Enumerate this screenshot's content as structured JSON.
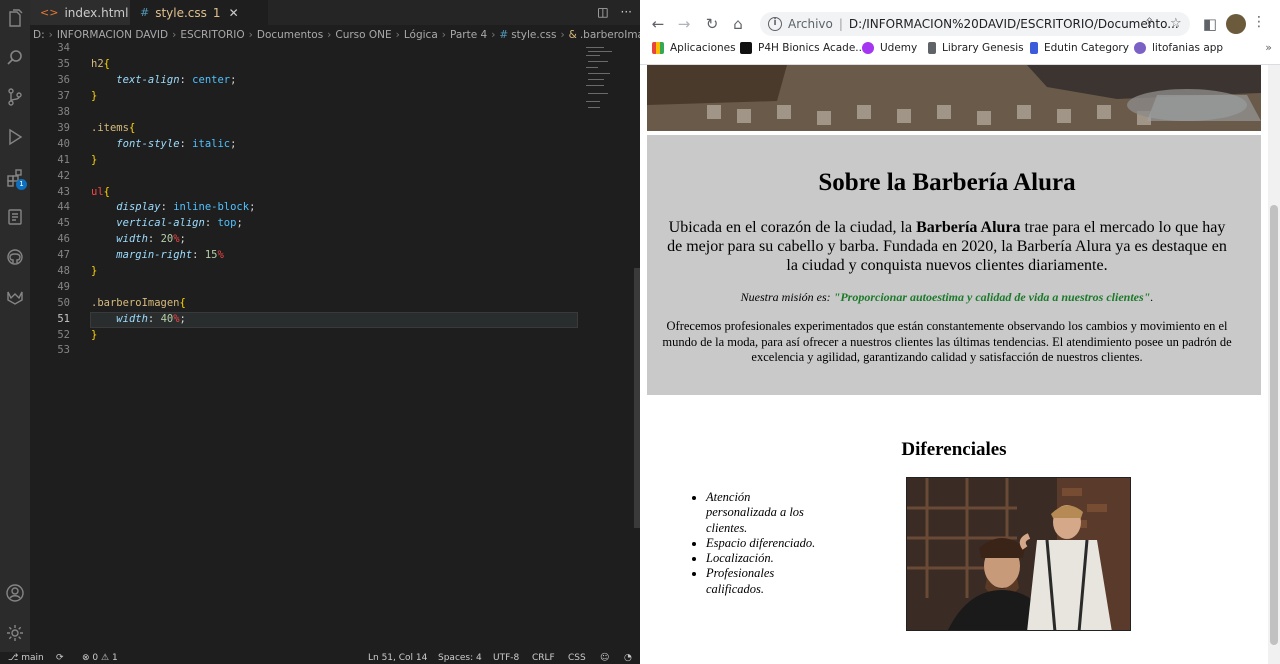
{
  "vscode": {
    "tabs": [
      {
        "icon": "<>",
        "label": "index.html"
      },
      {
        "icon": "#",
        "label": "style.css",
        "modified": "1"
      }
    ],
    "breadcrumb": [
      "D:",
      "INFORMACION DAVID",
      "ESCRITORIO",
      "Documentos",
      "Curso ONE",
      "Lógica",
      "Parte 4",
      "style.css",
      ".barberoImagen"
    ],
    "line_numbers": [
      "34",
      "35",
      "36",
      "37",
      "38",
      "39",
      "40",
      "41",
      "42",
      "43",
      "44",
      "45",
      "46",
      "47",
      "48",
      "49",
      "50",
      "51",
      "52",
      "53"
    ],
    "code": {
      "l35_sel": "h2",
      "l35_brace": "{",
      "l36_prop": "text-align",
      "l36_val": "center",
      "l37": "}",
      "l39_sel": ".items",
      "l39_brace": "{",
      "l40_prop": "font-style",
      "l40_val": "italic",
      "l41": "}",
      "l43_sel": "ul",
      "l43_brace": "{",
      "l44_prop": "display",
      "l44_val": "inline-block",
      "l45_prop": "vertical-align",
      "l45_val": "top",
      "l46_prop": "width",
      "l46_num": "20",
      "l46_unit": "%",
      "l47_prop": "margin-right",
      "l47_num": "15",
      "l47_unit": "%",
      "l48": "}",
      "l50_sel": ".barberoImagen",
      "l50_brace": "{",
      "l51_prop": "width",
      "l51_num": "40",
      "l51_unit": "%",
      "l52": "}"
    },
    "status": {
      "branch": "main",
      "problems": "0",
      "warnings": "1",
      "position": "Ln 51, Col 14",
      "spaces": "Spaces: 4",
      "encoding": "UTF-8",
      "eol": "CRLF",
      "language": "CSS"
    }
  },
  "browser": {
    "omnibox_prefix": "Archivo",
    "url": "D:/INFORMACION%20DAVID/ESCRITORIO/Documento...",
    "bookmarks": [
      {
        "label": "Aplicaciones",
        "color": "#e8453c"
      },
      {
        "label": "P4H Bionics Acade...",
        "color": "#111111"
      },
      {
        "label": "Udemy",
        "color": "#a435f0"
      },
      {
        "label": "Library Genesis",
        "color": "#5f6368"
      },
      {
        "label": "Edutin Category",
        "color": "#3b5bdb"
      },
      {
        "label": "litofanias app",
        "color": "#7b61c4"
      }
    ],
    "bookmarks_more": "»"
  },
  "page": {
    "sobre_title": "Sobre la Barbería Alura",
    "p1_before": "Ubicada en el corazón de la ciudad, la ",
    "p1_bold": "Barbería Alura",
    "p1_after": " trae para el mercado lo que hay de mejor para su cabello y barba. Fundada en 2020, la Barbería Alura ya es destaque en la ciudad y conquista nuevos clientes diariamente.",
    "p2_label": "Nuestra misión es: ",
    "p2_mission": "\"Proporcionar autoestima y calidad de vida a nuestros clientes\"",
    "p2_end": ".",
    "p3": "Ofrecemos profesionales experimentados que están constantemente observando los cambios y movimiento en el mundo de la moda, para así ofrecer a nuestros clientes las últimas tendencias. El atendimiento posee un padrón de excelencia y agilidad, garantizando calidad y satisfacción de nuestros clientes.",
    "diferenciales_title": "Diferenciales",
    "diferenciales": [
      "Atención personalizada a los clientes.",
      "Espacio diferenciado.",
      "Localización.",
      "Profesionales calificados."
    ]
  }
}
